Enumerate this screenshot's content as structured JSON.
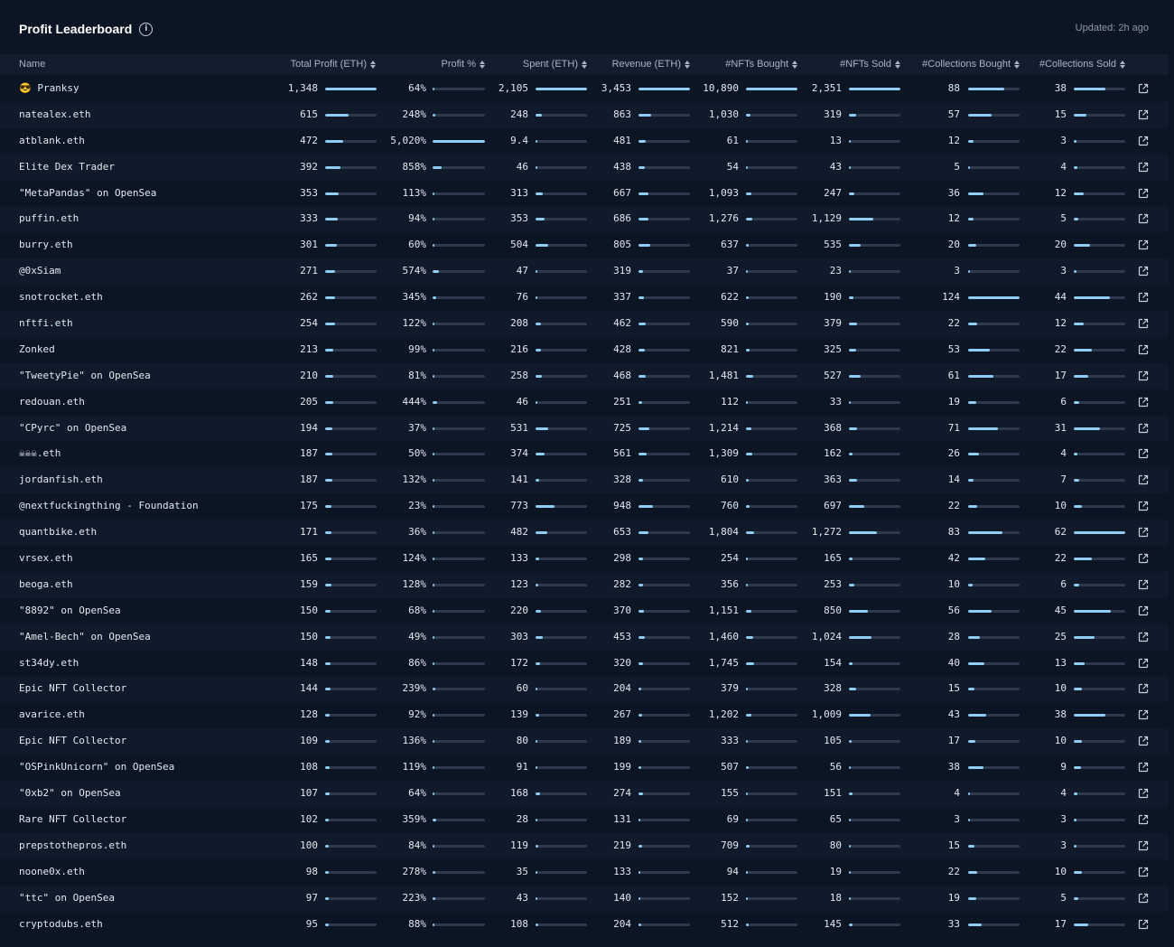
{
  "header": {
    "title": "Profit Leaderboard",
    "updated": "Updated: 2h ago"
  },
  "colors": {
    "accent": "#8fcdf5",
    "track": "#2d3a4e",
    "background": "#0c1524"
  },
  "columns": [
    {
      "key": "name",
      "label": "Name"
    },
    {
      "key": "profit",
      "label": "Total Profit (ETH)"
    },
    {
      "key": "pct",
      "label": "Profit %"
    },
    {
      "key": "spent",
      "label": "Spent (ETH)"
    },
    {
      "key": "revenue",
      "label": "Revenue (ETH)"
    },
    {
      "key": "bought",
      "label": "#NFTs Bought"
    },
    {
      "key": "sold",
      "label": "#NFTs Sold"
    },
    {
      "key": "cbought",
      "label": "#Collections Bought"
    },
    {
      "key": "csold",
      "label": "#Collections Sold"
    }
  ],
  "rows": [
    {
      "name": "😎 Pranksy",
      "profit": "1,348",
      "pct": "64%",
      "spent": "2,105",
      "revenue": "3,453",
      "bought": "10,890",
      "sold": "2,351",
      "cbought": "88",
      "csold": "38"
    },
    {
      "name": "natealex.eth",
      "profit": "615",
      "pct": "248%",
      "spent": "248",
      "revenue": "863",
      "bought": "1,030",
      "sold": "319",
      "cbought": "57",
      "csold": "15"
    },
    {
      "name": "atblank.eth",
      "profit": "472",
      "pct": "5,020%",
      "spent": "9.4",
      "revenue": "481",
      "bought": "61",
      "sold": "13",
      "cbought": "12",
      "csold": "3"
    },
    {
      "name": "Elite Dex Trader",
      "profit": "392",
      "pct": "858%",
      "spent": "46",
      "revenue": "438",
      "bought": "54",
      "sold": "43",
      "cbought": "5",
      "csold": "4"
    },
    {
      "name": "\"MetaPandas\" on OpenSea",
      "profit": "353",
      "pct": "113%",
      "spent": "313",
      "revenue": "667",
      "bought": "1,093",
      "sold": "247",
      "cbought": "36",
      "csold": "12"
    },
    {
      "name": "puffin.eth",
      "profit": "333",
      "pct": "94%",
      "spent": "353",
      "revenue": "686",
      "bought": "1,276",
      "sold": "1,129",
      "cbought": "12",
      "csold": "5"
    },
    {
      "name": "burry.eth",
      "profit": "301",
      "pct": "60%",
      "spent": "504",
      "revenue": "805",
      "bought": "637",
      "sold": "535",
      "cbought": "20",
      "csold": "20"
    },
    {
      "name": "@0xSiam",
      "profit": "271",
      "pct": "574%",
      "spent": "47",
      "revenue": "319",
      "bought": "37",
      "sold": "23",
      "cbought": "3",
      "csold": "3"
    },
    {
      "name": "snotrocket.eth",
      "profit": "262",
      "pct": "345%",
      "spent": "76",
      "revenue": "337",
      "bought": "622",
      "sold": "190",
      "cbought": "124",
      "csold": "44"
    },
    {
      "name": "nftfi.eth",
      "profit": "254",
      "pct": "122%",
      "spent": "208",
      "revenue": "462",
      "bought": "590",
      "sold": "379",
      "cbought": "22",
      "csold": "12"
    },
    {
      "name": "Zonked",
      "profit": "213",
      "pct": "99%",
      "spent": "216",
      "revenue": "428",
      "bought": "821",
      "sold": "325",
      "cbought": "53",
      "csold": "22"
    },
    {
      "name": "\"TweetyPie\" on OpenSea",
      "profit": "210",
      "pct": "81%",
      "spent": "258",
      "revenue": "468",
      "bought": "1,481",
      "sold": "527",
      "cbought": "61",
      "csold": "17"
    },
    {
      "name": "redouan.eth",
      "profit": "205",
      "pct": "444%",
      "spent": "46",
      "revenue": "251",
      "bought": "112",
      "sold": "33",
      "cbought": "19",
      "csold": "6"
    },
    {
      "name": "\"CPyrc\" on OpenSea",
      "profit": "194",
      "pct": "37%",
      "spent": "531",
      "revenue": "725",
      "bought": "1,214",
      "sold": "368",
      "cbought": "71",
      "csold": "31"
    },
    {
      "name": "☠☠☠.eth",
      "profit": "187",
      "pct": "50%",
      "spent": "374",
      "revenue": "561",
      "bought": "1,309",
      "sold": "162",
      "cbought": "26",
      "csold": "4"
    },
    {
      "name": "jordanfish.eth",
      "profit": "187",
      "pct": "132%",
      "spent": "141",
      "revenue": "328",
      "bought": "610",
      "sold": "363",
      "cbought": "14",
      "csold": "7"
    },
    {
      "name": "@nextfuckingthing - Foundation",
      "profit": "175",
      "pct": "23%",
      "spent": "773",
      "revenue": "948",
      "bought": "760",
      "sold": "697",
      "cbought": "22",
      "csold": "10"
    },
    {
      "name": "quantbike.eth",
      "profit": "171",
      "pct": "36%",
      "spent": "482",
      "revenue": "653",
      "bought": "1,804",
      "sold": "1,272",
      "cbought": "83",
      "csold": "62"
    },
    {
      "name": "vrsex.eth",
      "profit": "165",
      "pct": "124%",
      "spent": "133",
      "revenue": "298",
      "bought": "254",
      "sold": "165",
      "cbought": "42",
      "csold": "22"
    },
    {
      "name": "beoga.eth",
      "profit": "159",
      "pct": "128%",
      "spent": "123",
      "revenue": "282",
      "bought": "356",
      "sold": "253",
      "cbought": "10",
      "csold": "6"
    },
    {
      "name": "\"8892\" on OpenSea",
      "profit": "150",
      "pct": "68%",
      "spent": "220",
      "revenue": "370",
      "bought": "1,151",
      "sold": "850",
      "cbought": "56",
      "csold": "45"
    },
    {
      "name": "\"Amel-Bech\" on OpenSea",
      "profit": "150",
      "pct": "49%",
      "spent": "303",
      "revenue": "453",
      "bought": "1,460",
      "sold": "1,024",
      "cbought": "28",
      "csold": "25"
    },
    {
      "name": "st34dy.eth",
      "profit": "148",
      "pct": "86%",
      "spent": "172",
      "revenue": "320",
      "bought": "1,745",
      "sold": "154",
      "cbought": "40",
      "csold": "13"
    },
    {
      "name": "Epic NFT Collector",
      "profit": "144",
      "pct": "239%",
      "spent": "60",
      "revenue": "204",
      "bought": "379",
      "sold": "328",
      "cbought": "15",
      "csold": "10"
    },
    {
      "name": "avarice.eth",
      "profit": "128",
      "pct": "92%",
      "spent": "139",
      "revenue": "267",
      "bought": "1,202",
      "sold": "1,009",
      "cbought": "43",
      "csold": "38"
    },
    {
      "name": "Epic NFT Collector",
      "profit": "109",
      "pct": "136%",
      "spent": "80",
      "revenue": "189",
      "bought": "333",
      "sold": "105",
      "cbought": "17",
      "csold": "10"
    },
    {
      "name": "\"OSPinkUnicorn\" on OpenSea",
      "profit": "108",
      "pct": "119%",
      "spent": "91",
      "revenue": "199",
      "bought": "507",
      "sold": "56",
      "cbought": "38",
      "csold": "9"
    },
    {
      "name": "\"0xb2\" on OpenSea",
      "profit": "107",
      "pct": "64%",
      "spent": "168",
      "revenue": "274",
      "bought": "155",
      "sold": "151",
      "cbought": "4",
      "csold": "4"
    },
    {
      "name": "Rare NFT Collector",
      "profit": "102",
      "pct": "359%",
      "spent": "28",
      "revenue": "131",
      "bought": "69",
      "sold": "65",
      "cbought": "3",
      "csold": "3"
    },
    {
      "name": "prepstothepros.eth",
      "profit": "100",
      "pct": "84%",
      "spent": "119",
      "revenue": "219",
      "bought": "709",
      "sold": "80",
      "cbought": "15",
      "csold": "3"
    },
    {
      "name": "noone0x.eth",
      "profit": "98",
      "pct": "278%",
      "spent": "35",
      "revenue": "133",
      "bought": "94",
      "sold": "19",
      "cbought": "22",
      "csold": "10"
    },
    {
      "name": "\"ttc\" on OpenSea",
      "profit": "97",
      "pct": "223%",
      "spent": "43",
      "revenue": "140",
      "bought": "152",
      "sold": "18",
      "cbought": "19",
      "csold": "5"
    },
    {
      "name": "cryptodubs.eth",
      "profit": "95",
      "pct": "88%",
      "spent": "108",
      "revenue": "204",
      "bought": "512",
      "sold": "145",
      "cbought": "33",
      "csold": "17"
    }
  ]
}
